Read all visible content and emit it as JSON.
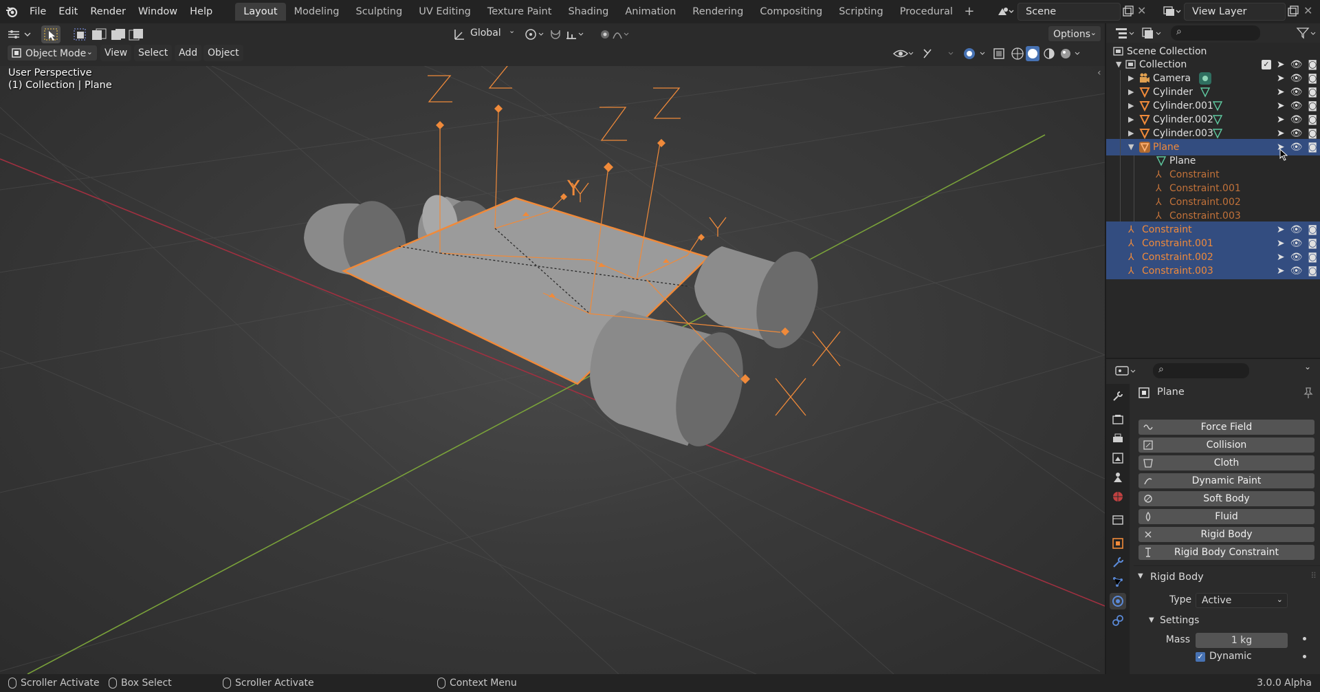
{
  "menu": {
    "items": [
      "File",
      "Edit",
      "Render",
      "Window",
      "Help"
    ]
  },
  "workspaces": {
    "tabs": [
      "Layout",
      "Modeling",
      "Sculpting",
      "UV Editing",
      "Texture Paint",
      "Shading",
      "Animation",
      "Rendering",
      "Compositing",
      "Scripting",
      "Procedural"
    ],
    "active": "Layout"
  },
  "scene": {
    "name": "Scene"
  },
  "view_layer": {
    "name": "View Layer"
  },
  "toolbar": {
    "transform_orientation": "Global",
    "options": "Options"
  },
  "viewport_header": {
    "mode": "Object Mode",
    "view": "View",
    "select": "Select",
    "add": "Add",
    "object": "Object"
  },
  "viewport": {
    "perspective": "User Perspective",
    "context": "(1) Collection | Plane",
    "axis_labels": {
      "x": "X",
      "y": "Y",
      "z": "Z"
    }
  },
  "outliner": {
    "root": "Scene Collection",
    "collection": "Collection",
    "rows": [
      {
        "label": "Camera",
        "type": "camera"
      },
      {
        "label": "Cylinder",
        "type": "mesh"
      },
      {
        "label": "Cylinder.001",
        "type": "mesh"
      },
      {
        "label": "Cylinder.002",
        "type": "mesh"
      },
      {
        "label": "Cylinder.003",
        "type": "mesh"
      },
      {
        "label": "Plane",
        "type": "mesh",
        "selected": true,
        "expanded": true
      }
    ],
    "plane_children": [
      "Plane",
      "Constraint",
      "Constraint.001",
      "Constraint.002",
      "Constraint.003"
    ],
    "constraints": [
      "Constraint",
      "Constraint.001",
      "Constraint.002",
      "Constraint.003"
    ]
  },
  "properties": {
    "object_name": "Plane",
    "physics_buttons": [
      "Force Field",
      "Collision",
      "Cloth",
      "Dynamic Paint",
      "Soft Body",
      "Fluid",
      "Rigid Body",
      "Rigid Body Constraint"
    ],
    "rigid_body": {
      "panel": "Rigid Body",
      "type_label": "Type",
      "type_value": "Active",
      "settings": "Settings",
      "mass_label": "Mass",
      "mass_value": "1 kg",
      "dynamic_label": "Dynamic",
      "dynamic_checked": true
    }
  },
  "status": {
    "left": "Scroller Activate",
    "box": "Box Select",
    "middle": "Scroller Activate",
    "context": "Context Menu",
    "version": "3.0.0 Alpha"
  },
  "colors": {
    "accent": "#f08a3a",
    "selection": "#334d80",
    "x_axis": "#a03040",
    "y_axis": "#7aa23a"
  }
}
